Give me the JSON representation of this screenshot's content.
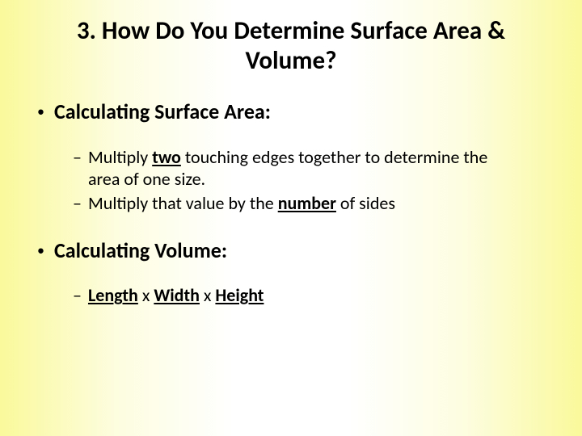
{
  "title": "3. How Do You Determine Surface Area & Volume?",
  "sa_heading": "Calculating Surface Area:",
  "sa_step1_pre": "Multiply ",
  "sa_step1_u": "two",
  "sa_step1_post": " touching edges together to determine the area of one size.",
  "sa_step2_pre": "Multiply that value by the ",
  "sa_step2_u": "number",
  "sa_step2_post": " of sides",
  "vol_heading": "Calculating Volume:",
  "vol_length": "Length",
  "vol_x1": " x ",
  "vol_width": "Width",
  "vol_x2": " x ",
  "vol_height": "Height"
}
